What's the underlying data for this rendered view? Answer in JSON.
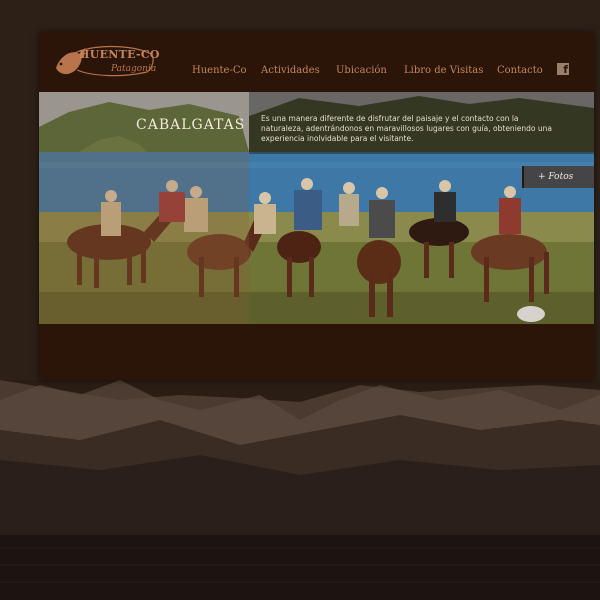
{
  "logo": {
    "name": "HUENTE-CO",
    "tagline": "Patagonia"
  },
  "nav": {
    "items": [
      {
        "label": "Huente-Co"
      },
      {
        "label": "Actividades"
      },
      {
        "label": "Ubicación"
      },
      {
        "label": "Libro de Visitas"
      },
      {
        "label": "Contacto"
      }
    ],
    "facebook_icon": "facebook-icon"
  },
  "hero": {
    "title": "CABALGATAS",
    "description": "Es una manera diferente de disfrutar del paisaje y el contacto con la naturaleza, adentrándonos en maravillosos lugares con guía, obteniendo una experiencia inolvidable para el visitante.",
    "fotos_label": "+ Fotos"
  },
  "colors": {
    "panel": "#2b1508",
    "nav_text": "#c4865b",
    "page_bg": "#2a1d14"
  }
}
